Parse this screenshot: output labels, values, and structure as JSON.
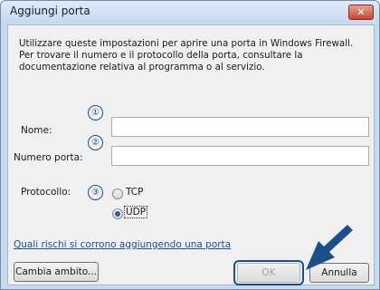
{
  "window": {
    "title": "Aggiungi porta",
    "close_glyph": "✕"
  },
  "description": "Utilizzare queste impostazioni per aprire una porta in Windows Firewall. Per trovare il numero e il protocollo della porta, consultare la documentazione relativa al programma o al servizio.",
  "fields": {
    "name_label": "Nome:",
    "name_value": "",
    "port_label": "Numero porta:",
    "port_value": ""
  },
  "protocol": {
    "label": "Protocollo:",
    "options": [
      {
        "label": "TCP",
        "selected": false
      },
      {
        "label": "UDP",
        "selected": true
      }
    ]
  },
  "callouts": [
    "①",
    "②",
    "③"
  ],
  "link_text": "Quali rischi si corrono aggiungendo una porta",
  "buttons": {
    "change_scope": "Cambia ambito...",
    "ok": "OK",
    "cancel": "Annulla"
  },
  "colors": {
    "accent": "#1b4f8c",
    "link": "#1c4ea8"
  },
  "icons": {
    "arrow": "arrow-pointer-icon"
  }
}
